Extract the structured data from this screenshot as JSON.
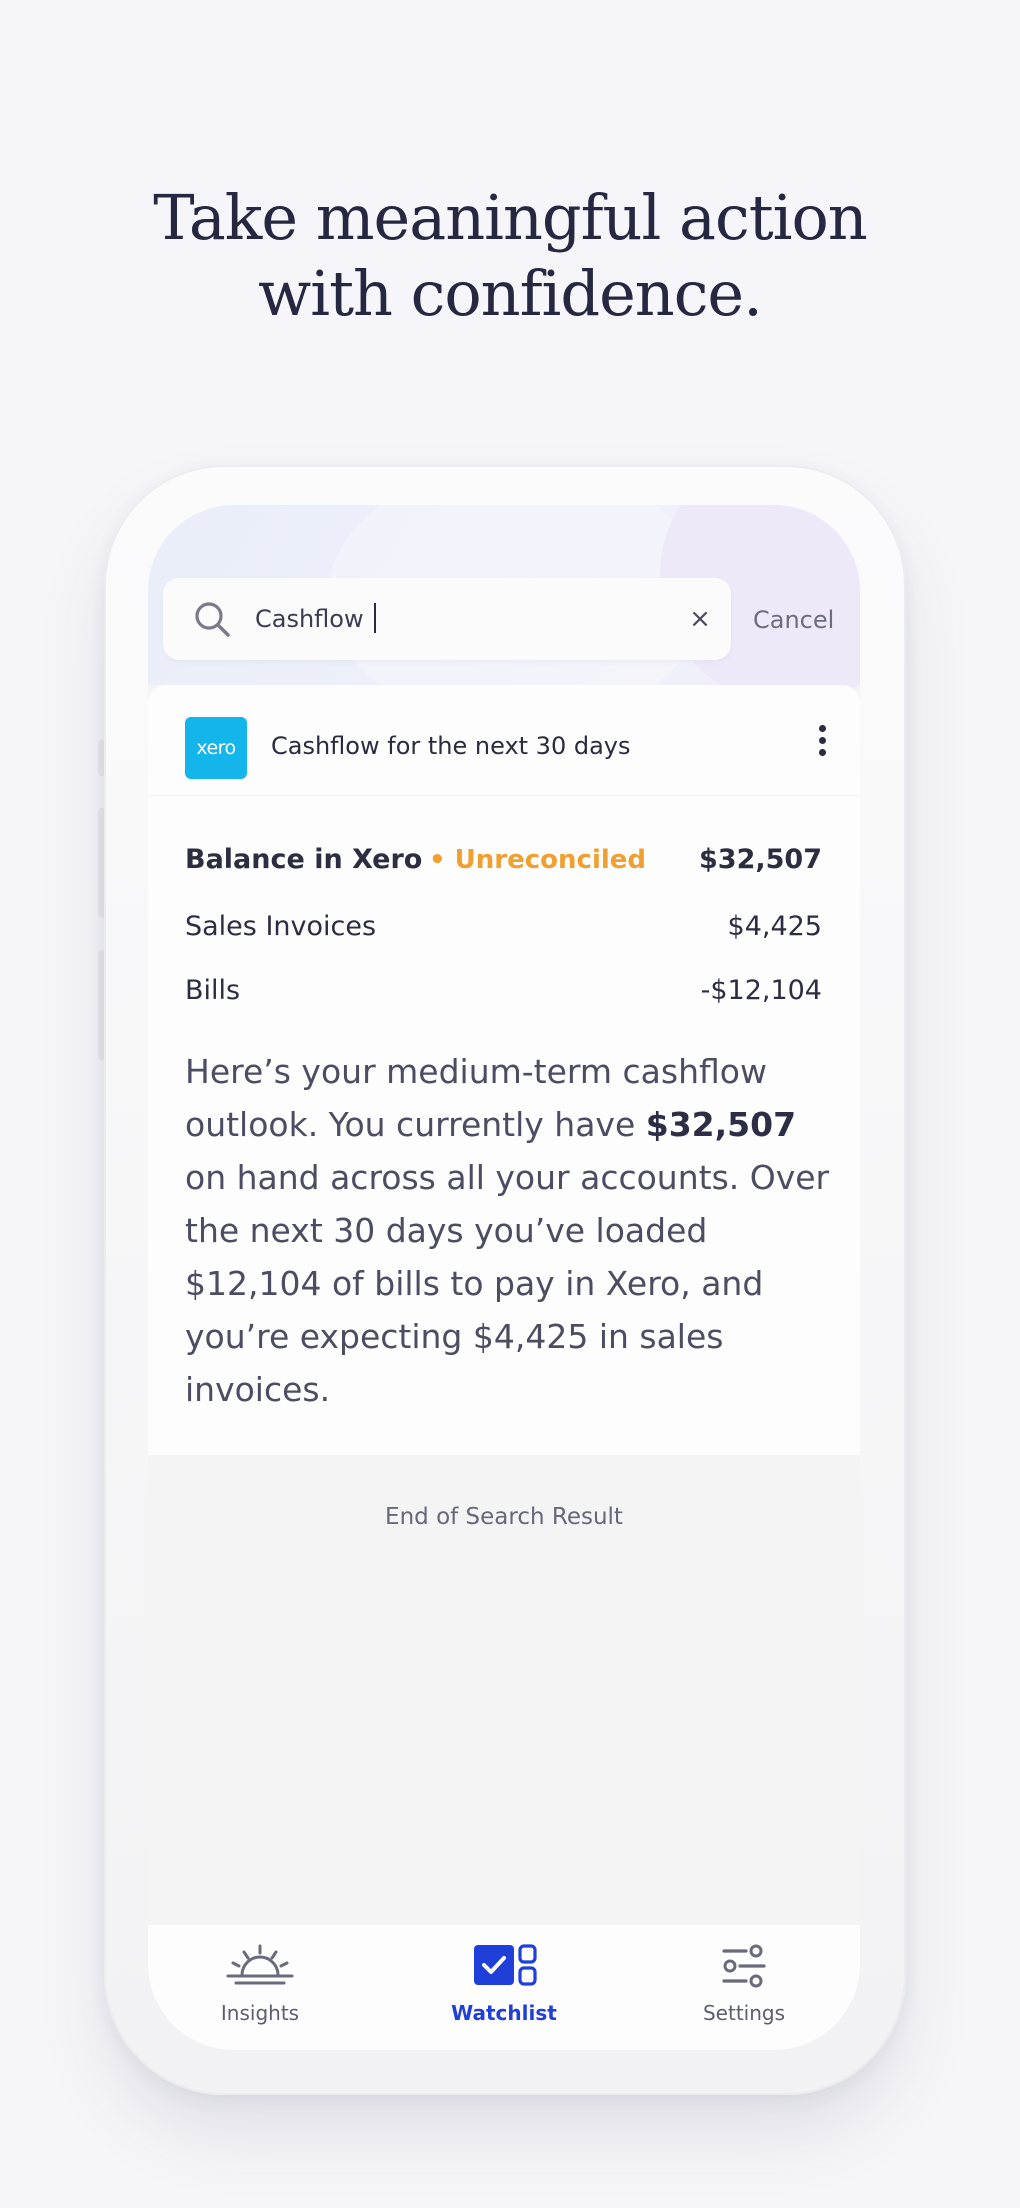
{
  "headline": {
    "line1": "Take meaningful action",
    "line2": "with confidence."
  },
  "search": {
    "query": "Cashflow",
    "cancel_label": "Cancel"
  },
  "card": {
    "title": "Cashflow for the next 30 days",
    "logo_text": "xero",
    "rows": [
      {
        "label": "Balance in Xero",
        "badge": "• Unreconciled",
        "value": "$32,507"
      },
      {
        "label": "Sales Invoices",
        "value": "$4,425"
      },
      {
        "label": "Bills",
        "value": "-$12,104"
      }
    ],
    "summary": {
      "part1": "Here’s your medium-term cashflow outlook. You currently have ",
      "bold": "$32,507",
      "part2": " on hand across all your accounts. Over the next 30 days you’ve loaded $12,104 of bills to pay in Xero, and you’re expecting $4,425 in sales invoices."
    }
  },
  "end_text": "End of Search Result",
  "nav": {
    "items": [
      {
        "label": "Insights",
        "icon": "sunrise-icon"
      },
      {
        "label": "Watchlist",
        "icon": "watchlist-icon"
      },
      {
        "label": "Settings",
        "icon": "sliders-icon"
      }
    ],
    "active": "Watchlist"
  },
  "colors": {
    "accent": "#1f3fd8",
    "warning": "#f0a030",
    "xero": "#13b5ea"
  }
}
